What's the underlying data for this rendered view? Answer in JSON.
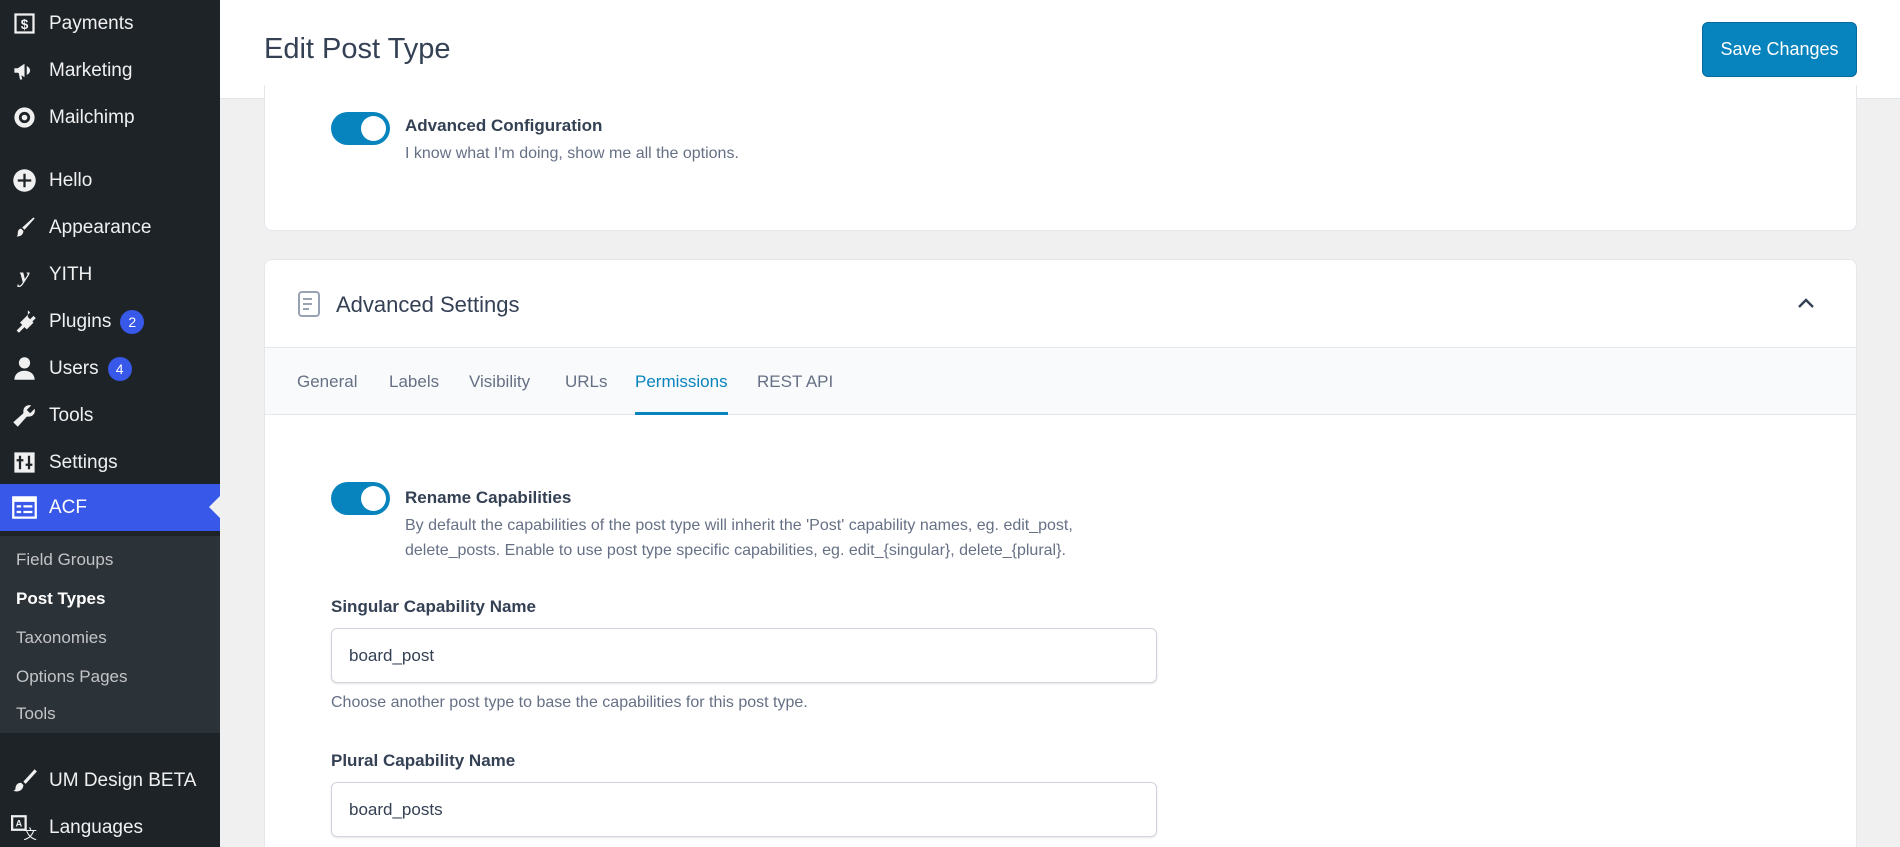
{
  "sidebar": {
    "items": [
      {
        "label": "Payments",
        "icon": "dollar-icon"
      },
      {
        "label": "Marketing",
        "icon": "megaphone-icon"
      },
      {
        "label": "Mailchimp",
        "icon": "mailchimp-icon"
      },
      {
        "label": "Hello",
        "icon": "plus-circle-icon"
      },
      {
        "label": "Appearance",
        "icon": "paintbrush-icon"
      },
      {
        "label": "YITH",
        "icon": "yith-icon"
      },
      {
        "label": "Plugins",
        "icon": "plug-icon",
        "badge": "2"
      },
      {
        "label": "Users",
        "icon": "user-icon",
        "badge": "4"
      },
      {
        "label": "Tools",
        "icon": "wrench-icon"
      },
      {
        "label": "Settings",
        "icon": "sliders-icon"
      },
      {
        "label": "ACF",
        "icon": "acf-icon"
      },
      {
        "label": "UM Design BETA",
        "icon": "brush-icon"
      },
      {
        "label": "Languages",
        "icon": "translate-icon"
      }
    ],
    "submenu": [
      "Field Groups",
      "Post Types",
      "Taxonomies",
      "Options Pages",
      "Tools"
    ],
    "current_sub": "Post Types"
  },
  "header": {
    "title": "Edit Post Type",
    "save_label": "Save Changes"
  },
  "advanced_config": {
    "label": "Advanced Configuration",
    "desc": "I know what I'm doing, show me all the options.",
    "enabled": true
  },
  "advanced_settings": {
    "title": "Advanced Settings",
    "tabs": [
      "General",
      "Labels",
      "Visibility",
      "URLs",
      "Permissions",
      "REST API"
    ],
    "active_tab": "Permissions",
    "rename_capabilities": {
      "label": "Rename Capabilities",
      "desc_line1": "By default the capabilities of the post type will inherit the 'Post' capability names, eg. edit_post,",
      "desc_line2": "delete_posts. Enable to use post type specific capabilities, eg. edit_{singular}, delete_{plural}.",
      "enabled": true
    },
    "singular": {
      "label": "Singular Capability Name",
      "value": "board_post",
      "hint": "Choose another post type to base the capabilities for this post type."
    },
    "plural": {
      "label": "Plural Capability Name",
      "value": "board_posts"
    }
  },
  "colors": {
    "sidebar_bg": "#1d2327",
    "accent": "#0783be",
    "menu_active": "#3858e9"
  }
}
